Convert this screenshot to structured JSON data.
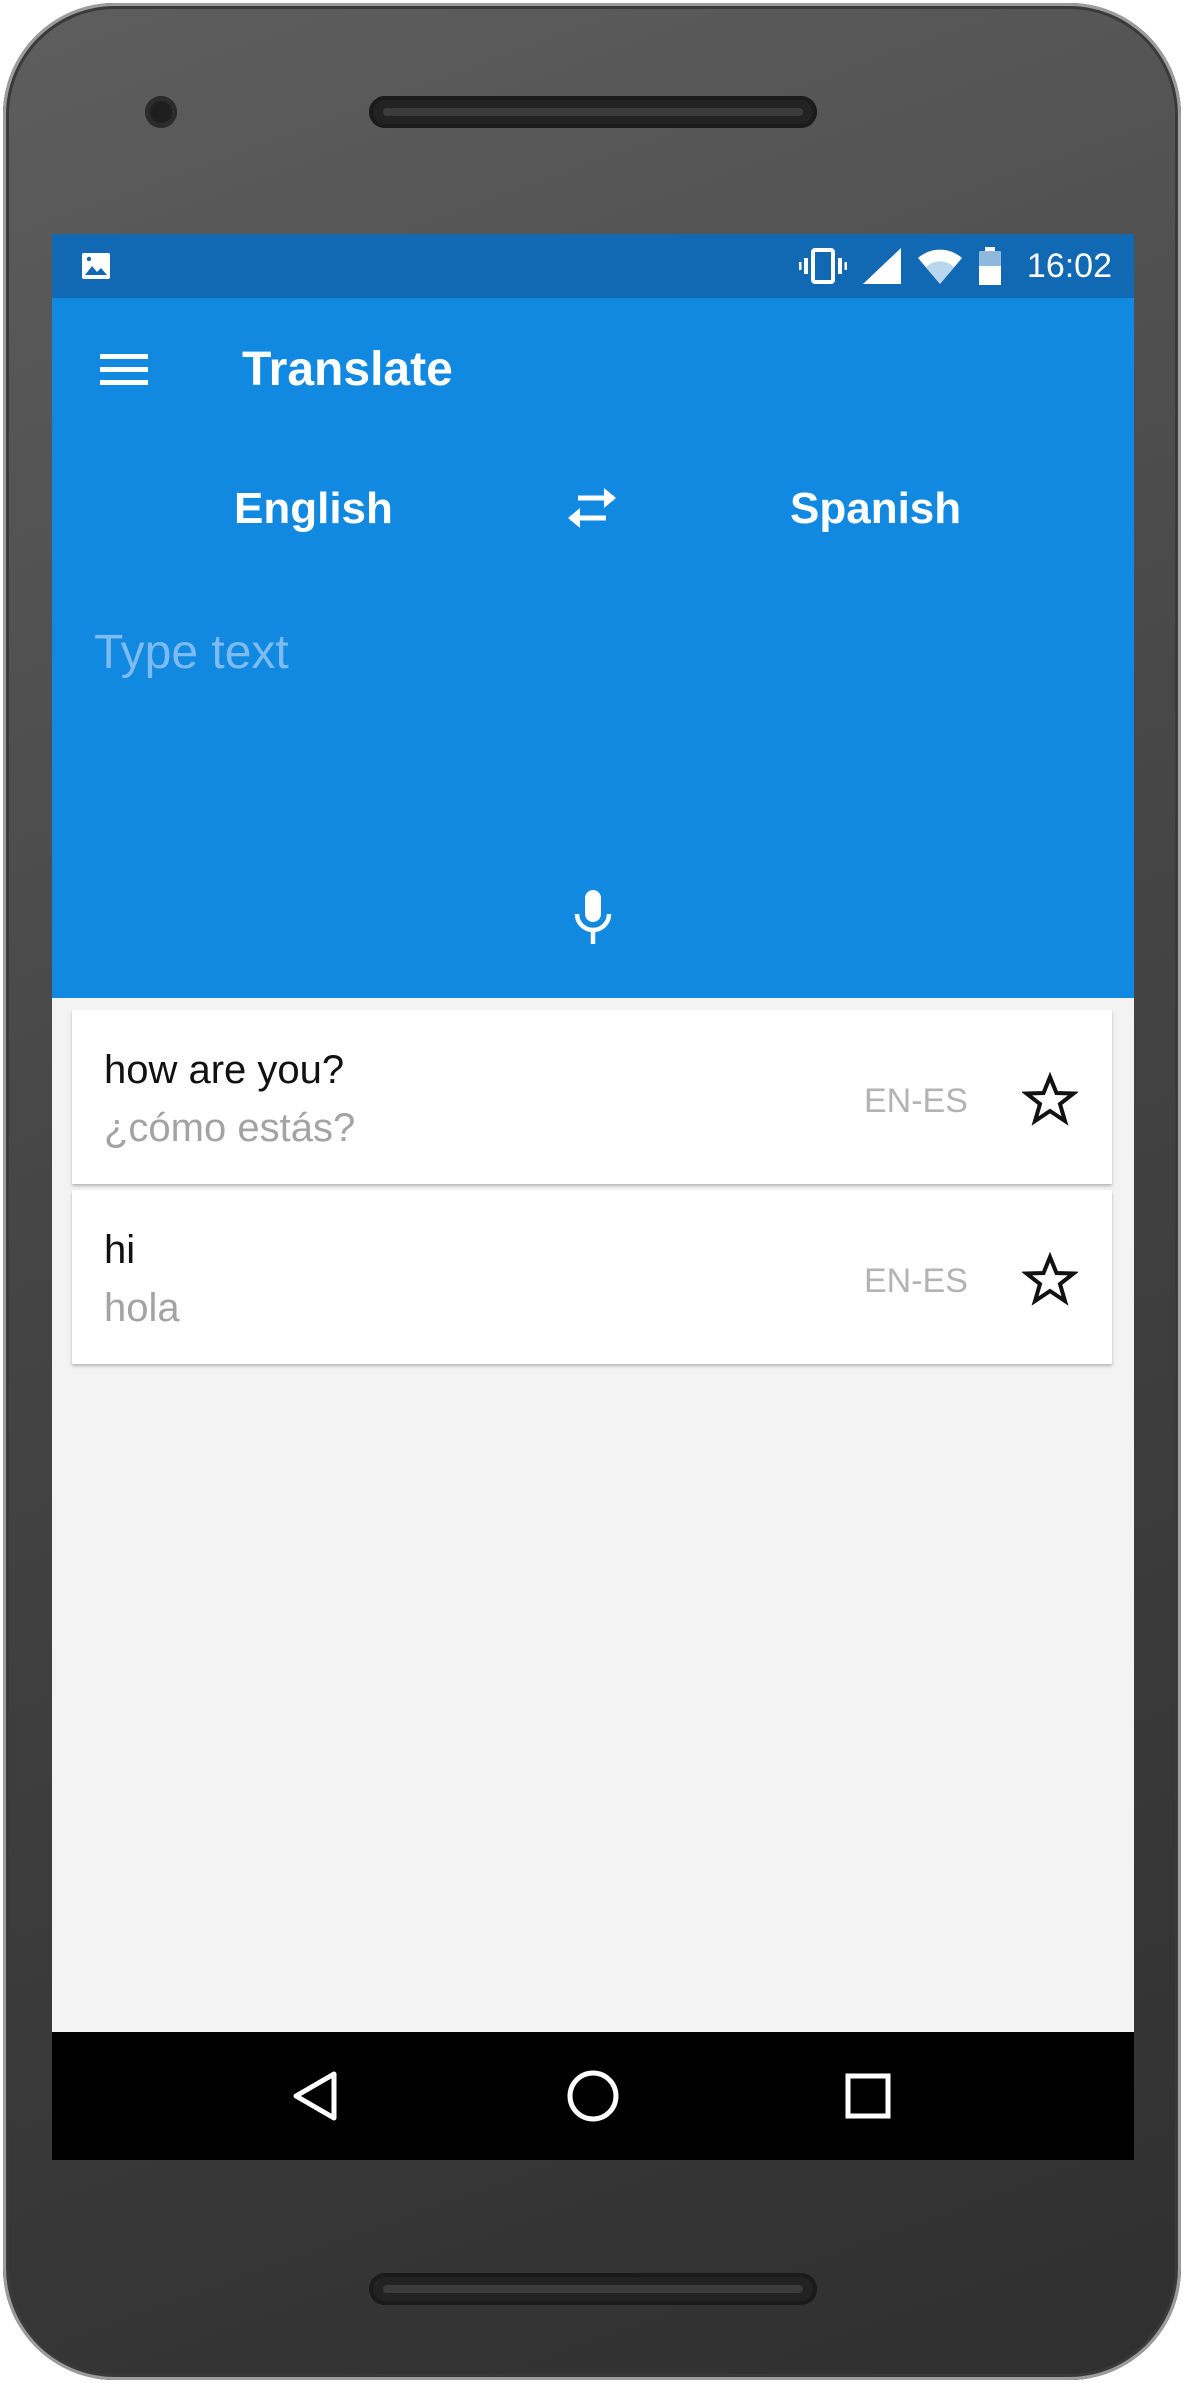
{
  "status_bar": {
    "time": "16:02",
    "icons": [
      "image-icon",
      "vibrate-icon",
      "cellular-signal-icon",
      "wifi-icon",
      "battery-icon"
    ]
  },
  "app_bar": {
    "menu_icon": "hamburger-menu-icon",
    "title": "Translate",
    "source_language": "English",
    "target_language": "Spanish",
    "swap_icon": "swap-arrows-icon",
    "input": {
      "value": "",
      "placeholder": "Type text"
    },
    "mic_icon": "microphone-icon",
    "background_color": "#1289e0"
  },
  "history": [
    {
      "source_text": "how are you?",
      "translated_text": "¿cómo estás?",
      "language_pair": "EN-ES",
      "starred": false
    },
    {
      "source_text": "hi",
      "translated_text": "hola",
      "language_pair": "EN-ES",
      "starred": false
    }
  ],
  "nav_bar": {
    "buttons": [
      "back-icon",
      "home-icon",
      "recent-apps-icon"
    ]
  }
}
